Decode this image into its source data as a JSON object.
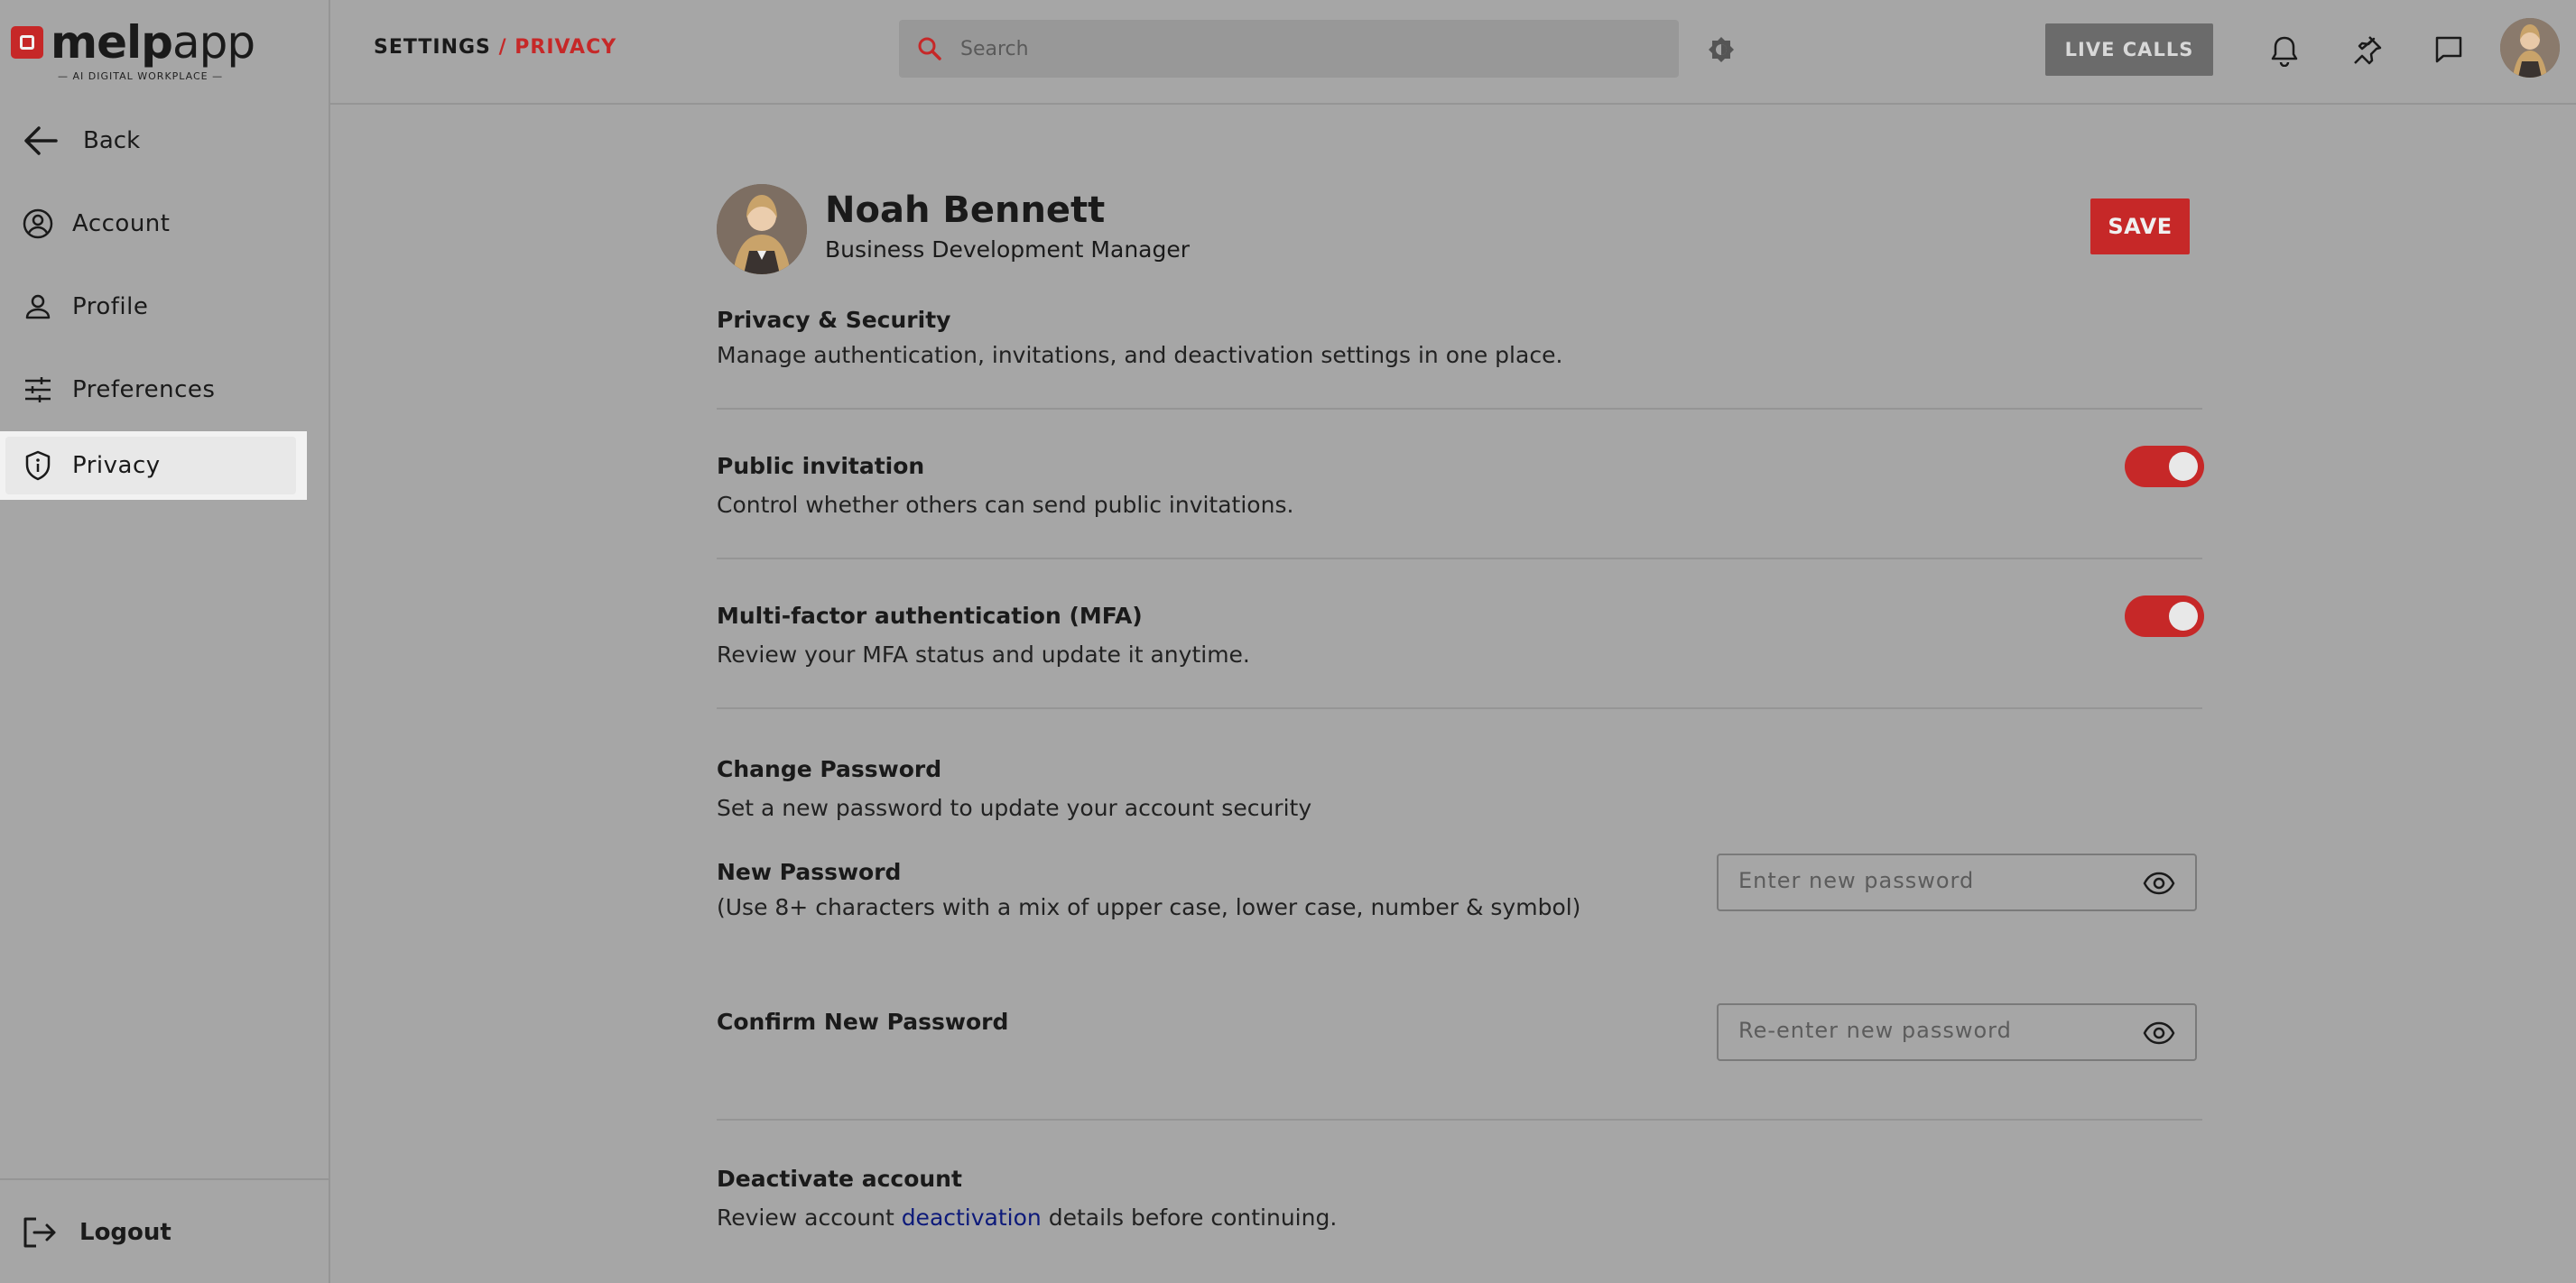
{
  "app": {
    "logo_text_bold": "melp",
    "logo_text_light": "app",
    "logo_tagline": "— AI DIGITAL WORKPLACE —"
  },
  "sidebar": {
    "back_label": "Back",
    "items": [
      {
        "label": "Account",
        "icon": "account-circle-icon"
      },
      {
        "label": "Profile",
        "icon": "person-icon"
      },
      {
        "label": "Preferences",
        "icon": "sliders-icon"
      },
      {
        "label": "Privacy",
        "icon": "shield-icon",
        "active": true
      }
    ],
    "logout_label": "Logout"
  },
  "header": {
    "breadcrumb_root": "SETTINGS",
    "breadcrumb_sep": " / ",
    "breadcrumb_current": "PRIVACY",
    "search_placeholder": "Search",
    "live_calls_label": "LIVE CALLS"
  },
  "profile": {
    "name": "Noah Bennett",
    "title": "Business Development Manager",
    "save_label": "SAVE"
  },
  "privacy_section": {
    "title": "Privacy & Security",
    "description": "Manage authentication, invitations, and deactivation settings in one place."
  },
  "public_invitation": {
    "title": "Public invitation",
    "description": "Control whether others can send public invitations.",
    "enabled": true
  },
  "mfa": {
    "title": "Multi-factor authentication (MFA)",
    "description": "Review your MFA status and update it anytime.",
    "enabled": true
  },
  "change_password": {
    "title": "Change Password",
    "description": "Set a new password to update your account security",
    "new_label": "New Password",
    "new_hint": "(Use 8+ characters with a mix of upper case, lower case, number & symbol)",
    "new_placeholder": "Enter new password",
    "confirm_label": "Confirm New Password",
    "confirm_placeholder": "Re-enter new password"
  },
  "deactivate": {
    "title": "Deactivate account",
    "desc_before": "Review account ",
    "desc_link": "deactivation",
    "desc_after": " details before continuing."
  },
  "colors": {
    "accent": "#c62828",
    "background": "#a6a6a6",
    "link": "#0d1a7a"
  }
}
